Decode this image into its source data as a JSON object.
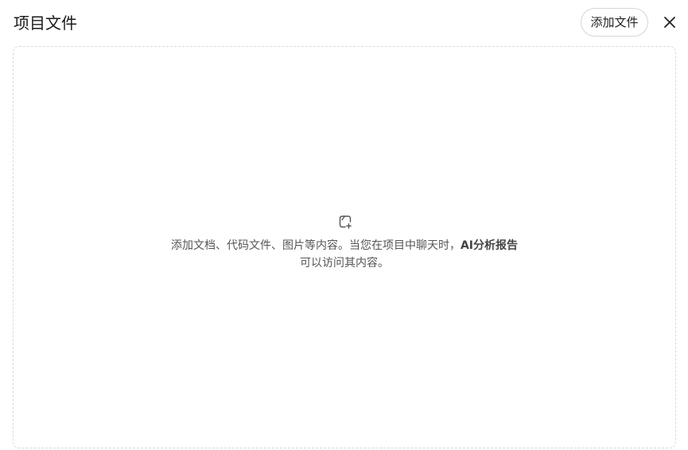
{
  "dialog": {
    "title": "项目文件",
    "add_button_label": "添加文件",
    "close_icon": "close-icon"
  },
  "empty_state": {
    "icon": "add-file-icon",
    "text_before": "添加文档、代码文件、图片等内容。当您在项目中聊天时，",
    "highlight": "AI分析报告",
    "text_after": " 可以访问其内容。"
  }
}
